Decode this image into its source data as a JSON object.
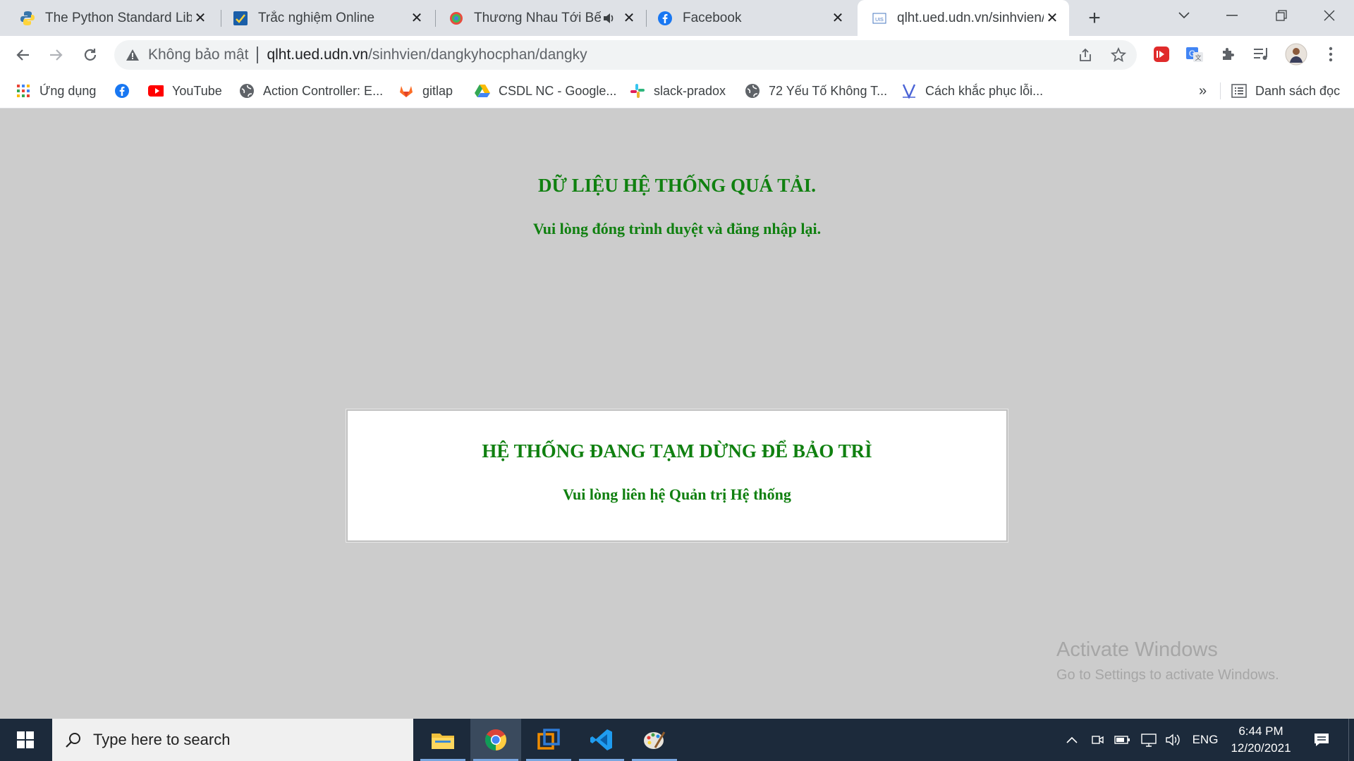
{
  "browser": {
    "tabs": [
      {
        "title": "The Python Standard Library",
        "active": false
      },
      {
        "title": "Trắc nghiệm Online",
        "active": false
      },
      {
        "title": "Thương Nhau Tới Bến",
        "active": false,
        "audio": true
      },
      {
        "title": "Facebook",
        "active": false
      },
      {
        "title": "qlht.ued.udn.vn/sinhvien/dangkyhocphan/dangky",
        "active": true
      }
    ],
    "address": {
      "security_label": "Không bảo mật",
      "host": "qlht.ued.udn.vn",
      "path": "/sinhvien/dangkyhocphan/dangky"
    },
    "bookmarks": [
      {
        "label": "Ứng dụng",
        "icon": "apps-grid-icon"
      },
      {
        "label": "",
        "icon": "facebook-icon"
      },
      {
        "label": "YouTube",
        "icon": "youtube-icon"
      },
      {
        "label": "Action Controller: E...",
        "icon": "globe-icon"
      },
      {
        "label": "gitlap",
        "icon": "gitlab-icon"
      },
      {
        "label": "CSDL NC - Google...",
        "icon": "google-drive-icon"
      },
      {
        "label": "slack-pradox",
        "icon": "slack-icon"
      },
      {
        "label": "72 Yếu Tố Không T...",
        "icon": "globe-icon"
      },
      {
        "label": "Cách khắc phục lỗi...",
        "icon": "v-logo-icon"
      }
    ],
    "more_bookmarks": "»",
    "reading_list": "Danh sách đọc"
  },
  "page": {
    "overload_title": "DỮ LIỆU HỆ THỐNG QUÁ TẢI.",
    "overload_subtitle": "Vui lòng đóng trình duyệt và đăng nhập lại.",
    "maintenance_title": "HỆ THỐNG ĐANG TẠM DỪNG ĐỂ BẢO TRÌ",
    "maintenance_subtitle": "Vui lòng liên hệ Quản trị Hệ thống",
    "text_color": "#108010"
  },
  "watermark": {
    "line1": "Activate Windows",
    "line2": "Go to Settings to activate Windows."
  },
  "taskbar": {
    "search_placeholder": "Type here to search",
    "apps": [
      "file-explorer-icon",
      "chrome-icon",
      "vmware-icon",
      "vscode-icon",
      "paint-icon"
    ],
    "language": "ENG",
    "time": "6:44 PM",
    "date": "12/20/2021"
  }
}
